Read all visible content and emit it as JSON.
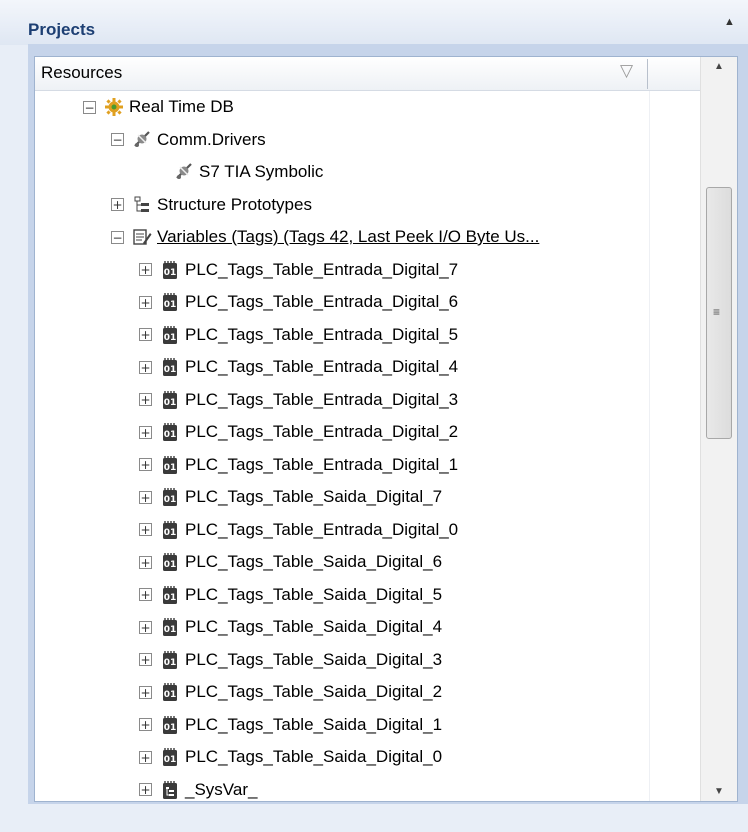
{
  "panel": {
    "title": "Projects",
    "collapse_icon": "triangle-up-icon"
  },
  "tree": {
    "column_header": "Resources",
    "filter_icon": "filter-icon",
    "nodes": [
      {
        "label": "Real Time DB",
        "expander": "minus",
        "icon": "gear-icon"
      },
      {
        "label": "Comm.Drivers",
        "expander": "minus",
        "icon": "driver-icon"
      },
      {
        "label": "S7 TIA Symbolic",
        "expander": "none",
        "icon": "driver-icon"
      },
      {
        "label": "Structure Prototypes",
        "expander": "plus",
        "icon": "structure-icon"
      },
      {
        "label": "Variables (Tags) (Tags 42, Last Peek I/O Byte Us...",
        "expander": "minus",
        "icon": "variables-icon"
      },
      {
        "label": "PLC_Tags_Table_Entrada_Digital_7",
        "expander": "plus",
        "icon": "tag-group-icon"
      },
      {
        "label": "PLC_Tags_Table_Entrada_Digital_6",
        "expander": "plus",
        "icon": "tag-group-icon"
      },
      {
        "label": "PLC_Tags_Table_Entrada_Digital_5",
        "expander": "plus",
        "icon": "tag-group-icon"
      },
      {
        "label": "PLC_Tags_Table_Entrada_Digital_4",
        "expander": "plus",
        "icon": "tag-group-icon"
      },
      {
        "label": "PLC_Tags_Table_Entrada_Digital_3",
        "expander": "plus",
        "icon": "tag-group-icon"
      },
      {
        "label": "PLC_Tags_Table_Entrada_Digital_2",
        "expander": "plus",
        "icon": "tag-group-icon"
      },
      {
        "label": "PLC_Tags_Table_Entrada_Digital_1",
        "expander": "plus",
        "icon": "tag-group-icon"
      },
      {
        "label": "PLC_Tags_Table_Saida_Digital_7",
        "expander": "plus",
        "icon": "tag-group-icon"
      },
      {
        "label": "PLC_Tags_Table_Entrada_Digital_0",
        "expander": "plus",
        "icon": "tag-group-icon"
      },
      {
        "label": "PLC_Tags_Table_Saida_Digital_6",
        "expander": "plus",
        "icon": "tag-group-icon"
      },
      {
        "label": "PLC_Tags_Table_Saida_Digital_5",
        "expander": "plus",
        "icon": "tag-group-icon"
      },
      {
        "label": "PLC_Tags_Table_Saida_Digital_4",
        "expander": "plus",
        "icon": "tag-group-icon"
      },
      {
        "label": "PLC_Tags_Table_Saida_Digital_3",
        "expander": "plus",
        "icon": "tag-group-icon"
      },
      {
        "label": "PLC_Tags_Table_Saida_Digital_2",
        "expander": "plus",
        "icon": "tag-group-icon"
      },
      {
        "label": "PLC_Tags_Table_Saida_Digital_1",
        "expander": "plus",
        "icon": "tag-group-icon"
      },
      {
        "label": "PLC_Tags_Table_Saida_Digital_0",
        "expander": "plus",
        "icon": "tag-group-icon"
      },
      {
        "label": "_SysVar_",
        "expander": "plus",
        "icon": "struct-var-icon"
      }
    ]
  },
  "colors": {
    "accent": "#1d3f73",
    "icon_dark": "#3a3a3a",
    "gear": "#e0a020",
    "gear_green": "#4a9a30"
  }
}
